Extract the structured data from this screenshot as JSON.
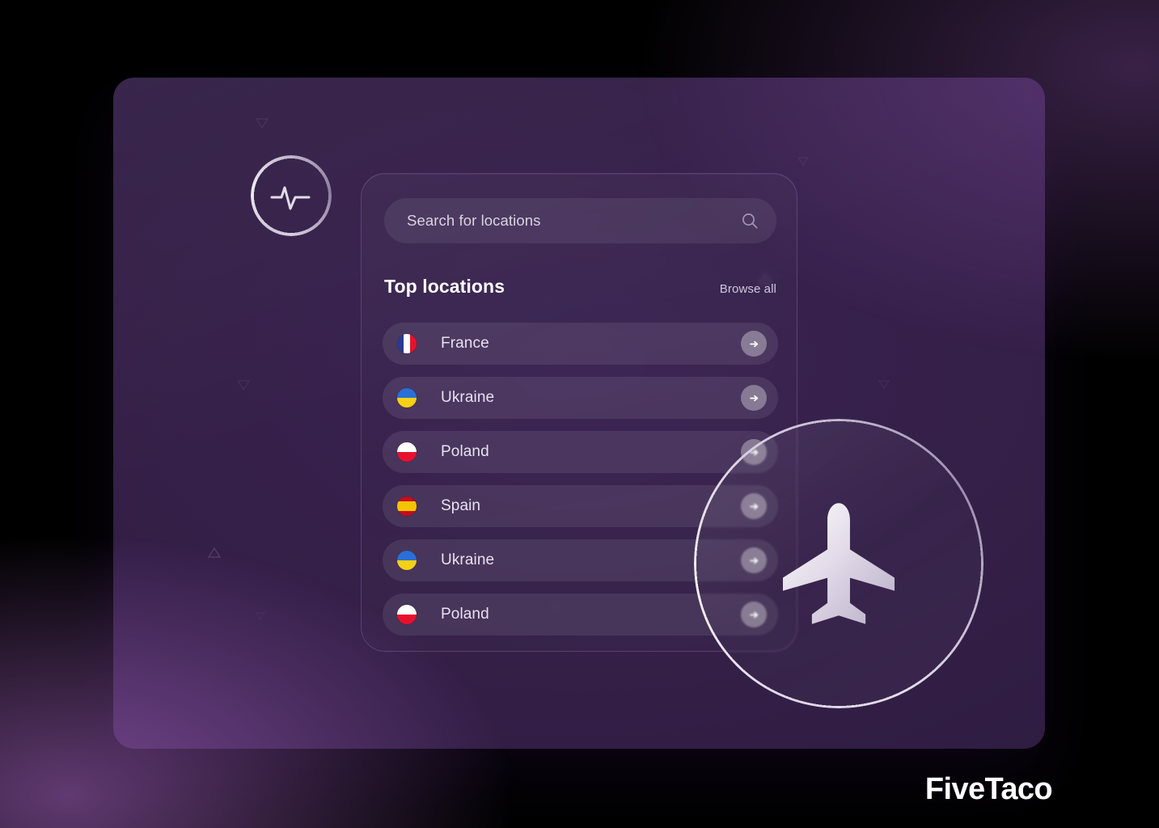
{
  "brand": {
    "wordmark": "FiveTaco"
  },
  "decor": {
    "pulse_icon": "pulse-activity-icon",
    "plane_icon": "airplane-icon",
    "triangles": 8
  },
  "search": {
    "placeholder": "Search for locations",
    "value": "",
    "icon": "search-icon"
  },
  "section": {
    "title": "Top locations",
    "browse_all": "Browse all"
  },
  "locations": [
    {
      "name": "France",
      "flag": "france-flag",
      "action_icon": "arrow-right-icon"
    },
    {
      "name": "Ukraine",
      "flag": "ukraine-flag",
      "action_icon": "arrow-right-icon"
    },
    {
      "name": "Poland",
      "flag": "poland-flag",
      "action_icon": "arrow-right-icon"
    },
    {
      "name": "Spain",
      "flag": "spain-flag",
      "action_icon": "arrow-right-icon"
    },
    {
      "name": "Ukraine",
      "flag": "ukraine-flag",
      "action_icon": "arrow-right-icon"
    },
    {
      "name": "Poland",
      "flag": "poland-flag",
      "action_icon": "arrow-right-icon"
    }
  ],
  "colors": {
    "backdrop_dark": "#4e2c78",
    "backdrop_light": "#a060c0",
    "card": "#35204a",
    "panel_row": "rgba(255,255,255,0.085)",
    "text_primary": "#ffffff",
    "text_secondary": "#cfc8dd",
    "flag_france_blue": "#2b3a8f",
    "flag_france_red": "#e8112d",
    "flag_ukraine_blue": "#2b6fd6",
    "flag_ukraine_yellow": "#f7d117",
    "flag_poland_white": "#ffffff",
    "flag_poland_red": "#e8112d",
    "flag_spain_red": "#c60b1e",
    "flag_spain_yellow": "#f5c400"
  }
}
